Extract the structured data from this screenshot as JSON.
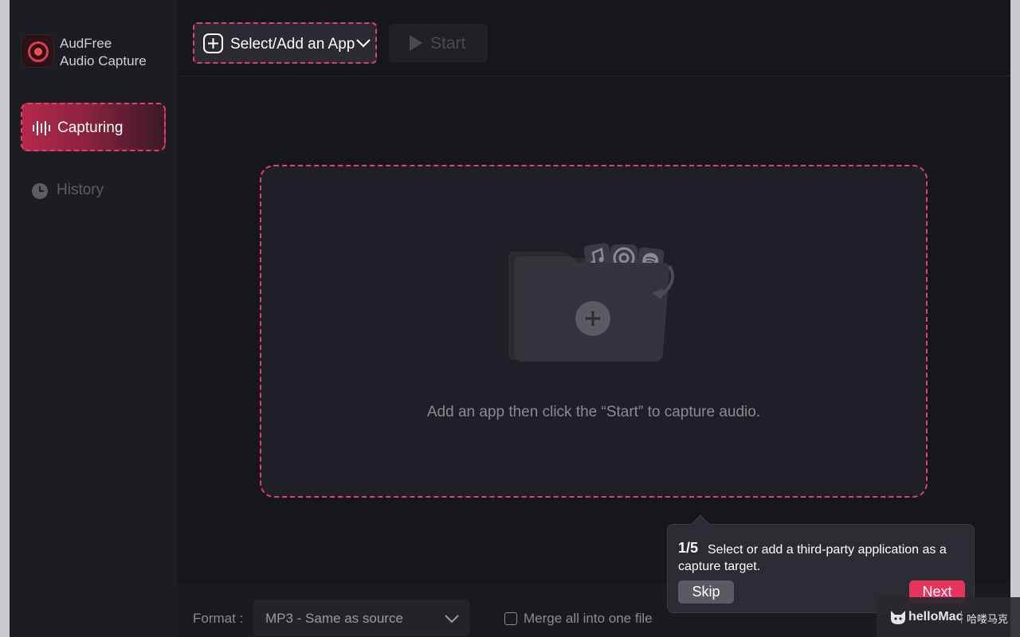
{
  "app": {
    "name_line1": "AudFree",
    "name_line2": "Audio Capture"
  },
  "sidebar": {
    "items": [
      {
        "label": "Capturing",
        "icon": "waveform-icon",
        "active": true
      },
      {
        "label": "History",
        "icon": "clock-icon",
        "active": false
      }
    ]
  },
  "toolbar": {
    "select_label": "Select/Add an App",
    "start_label": "Start"
  },
  "main": {
    "hint": "Add an app then click the “Start” to capture audio.",
    "illustration_icons": [
      "music-note-icon",
      "chrome-icon",
      "spotify-icon",
      "folder-icon",
      "plus-icon",
      "arrow-icon"
    ]
  },
  "footer": {
    "format_label": "Format :",
    "format_value": "MP3 - Same as source",
    "merge_label": "Merge all into one file",
    "merge_checked": false
  },
  "tooltip": {
    "step": "1/5",
    "message": "Select or add a third-party application as a capture target.",
    "skip_label": "Skip",
    "next_label": "Next"
  },
  "watermark": {
    "brand": "helloMac",
    "cn": "哈喽马克"
  },
  "colors": {
    "accent": "#e0406a",
    "background": "#16171c",
    "sidebar": "#1c1d22"
  }
}
